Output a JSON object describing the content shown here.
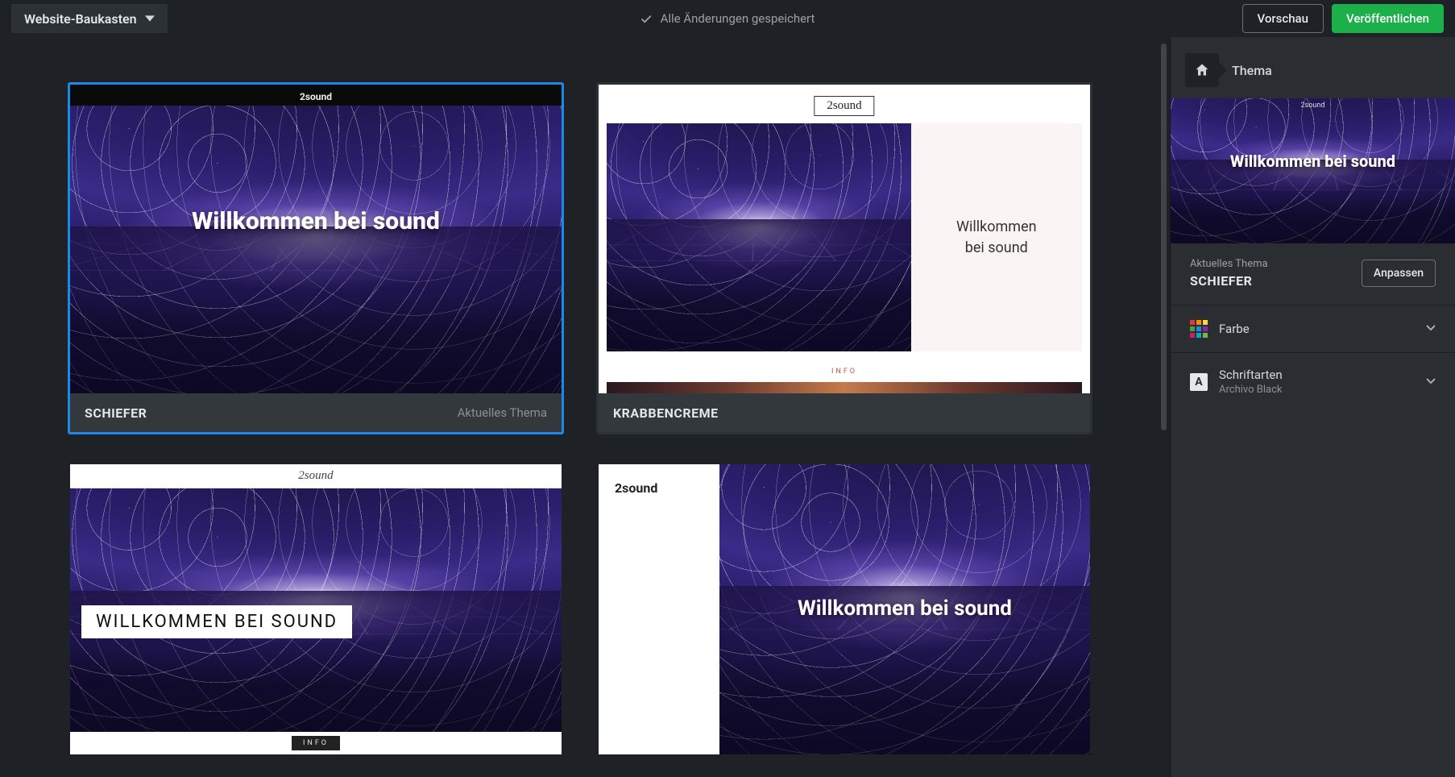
{
  "topbar": {
    "site_dropdown": "Website-Baukasten",
    "save_status": "Alle Änderungen gespeichert",
    "preview_btn": "Vorschau",
    "publish_btn": "Veröffentlichen"
  },
  "themes": {
    "brand": "2sound",
    "hero_text": "Willkommen bei sound",
    "cards": [
      {
        "name": "SCHIEFER",
        "current_label": "Aktuelles Thema",
        "selected": true
      },
      {
        "name": "KRABBENCREME",
        "side_text_line1": "Willkommen",
        "side_text_line2": "bei sound",
        "info": "INFO"
      },
      {
        "hero_text": "WILLKOMMEN BEI SOUND",
        "info": "INFO"
      },
      {
        "hero_text": "Willkommen bei sound"
      }
    ]
  },
  "sidebar": {
    "title": "Thema",
    "preview_hero": "Willkommen bei sound",
    "current_label": "Aktuelles Thema",
    "current_value": "SCHIEFER",
    "customize_btn": "Anpassen",
    "sections": {
      "color": {
        "label": "Farbe"
      },
      "fonts": {
        "label": "Schriftarten",
        "value": "Archivo Black",
        "badge": "A"
      }
    }
  }
}
